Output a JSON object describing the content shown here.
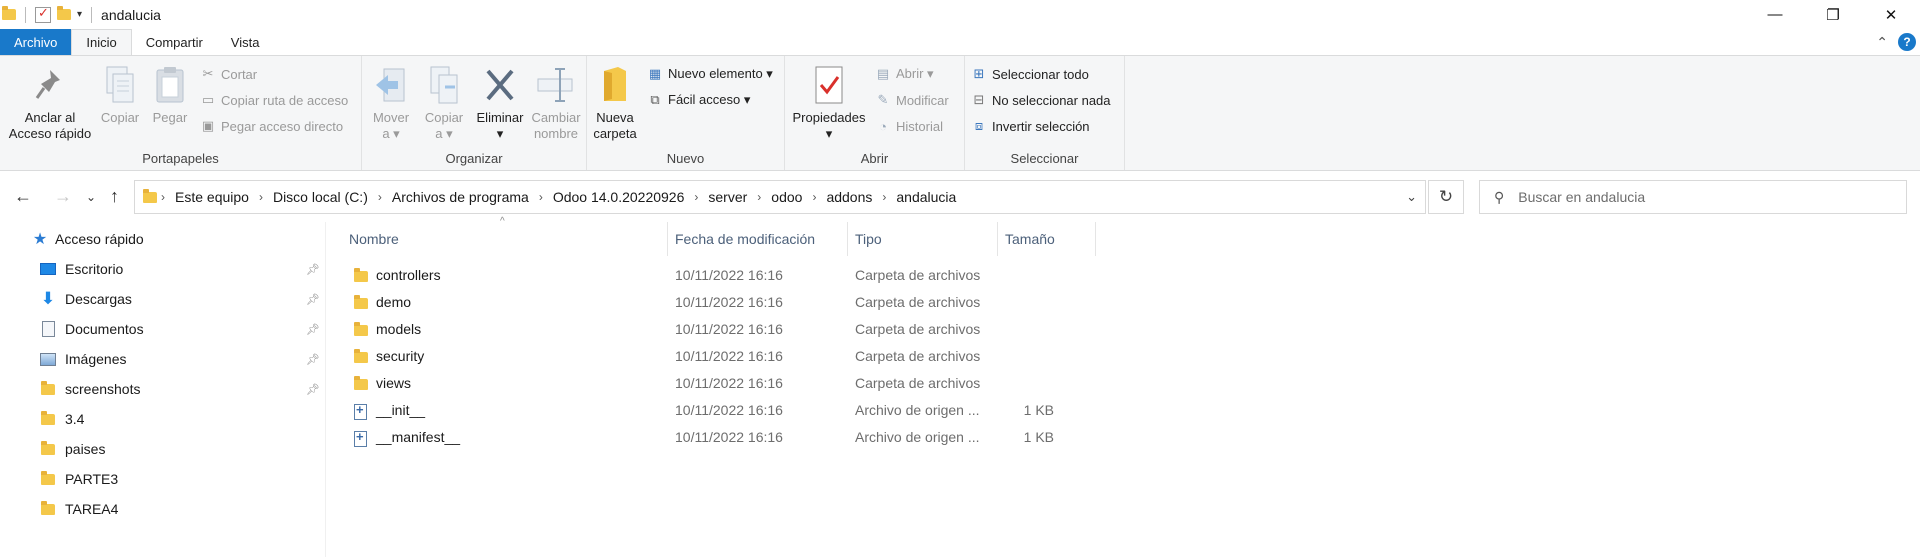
{
  "title_bar": {
    "title": "andalucia",
    "minimize": "—",
    "restore": "❐",
    "close": "✕"
  },
  "ribbon_tabs": {
    "file": "Archivo",
    "tabs": [
      "Inicio",
      "Compartir",
      "Vista"
    ],
    "collapse": "⌃",
    "help": "?"
  },
  "ribbon": {
    "portapapeles": {
      "label": "Portapapeles",
      "pin": "Anclar al\nAcceso rápido",
      "copy": "Copiar",
      "paste": "Pegar",
      "cut": "Cortar",
      "copy_path": "Copiar ruta de acceso",
      "paste_shortcut": "Pegar acceso directo"
    },
    "organizar": {
      "label": "Organizar",
      "move": "Mover\na ▾",
      "copy_to": "Copiar\na ▾",
      "delete": "Eliminar\n▾",
      "rename": "Cambiar\nnombre"
    },
    "nuevo": {
      "label": "Nuevo",
      "new_folder": "Nueva\ncarpeta",
      "new_item": "Nuevo elemento ▾",
      "easy_access": "Fácil acceso ▾"
    },
    "abrir": {
      "label": "Abrir",
      "properties": "Propiedades\n▾",
      "open": "Abrir ▾",
      "edit": "Modificar",
      "history": "Historial"
    },
    "seleccionar": {
      "label": "Seleccionar",
      "select_all": "Seleccionar todo",
      "select_none": "No seleccionar nada",
      "invert": "Invertir selección"
    }
  },
  "nav": {
    "back": "←",
    "forward": "→",
    "recent": "⌄",
    "up": "↑",
    "breadcrumbs": [
      "Este equipo",
      "Disco local (C:)",
      "Archivos de programa",
      "Odoo 14.0.20220926",
      "server",
      "odoo",
      "addons",
      "andalucia"
    ],
    "crumb_separator": "›",
    "dropdown": "⌄",
    "refresh": "↻",
    "search_placeholder": "Buscar en andalucia"
  },
  "sidebar": {
    "quick_access": "Acceso rápido",
    "items": [
      {
        "label": "Escritorio",
        "icon": "desktop-icon",
        "pinned": true
      },
      {
        "label": "Descargas",
        "icon": "downloads-icon",
        "pinned": true
      },
      {
        "label": "Documentos",
        "icon": "documents-icon",
        "pinned": true
      },
      {
        "label": "Imágenes",
        "icon": "pictures-icon",
        "pinned": true
      },
      {
        "label": "screenshots",
        "icon": "folder-icon",
        "pinned": true
      },
      {
        "label": "3.4",
        "icon": "folder-icon",
        "pinned": false
      },
      {
        "label": "paises",
        "icon": "folder-icon",
        "pinned": false
      },
      {
        "label": "PARTE3",
        "icon": "folder-icon",
        "pinned": false
      },
      {
        "label": "TAREA4",
        "icon": "folder-icon",
        "pinned": false
      }
    ]
  },
  "file_list": {
    "columns": {
      "name": "Nombre",
      "date": "Fecha de modificación",
      "type": "Tipo",
      "size": "Tamaño"
    },
    "sort_indicator": "^",
    "rows": [
      {
        "name": "controllers",
        "date": "10/11/2022 16:16",
        "type": "Carpeta de archivos",
        "size": "",
        "icon": "folder-icon"
      },
      {
        "name": "demo",
        "date": "10/11/2022 16:16",
        "type": "Carpeta de archivos",
        "size": "",
        "icon": "folder-icon"
      },
      {
        "name": "models",
        "date": "10/11/2022 16:16",
        "type": "Carpeta de archivos",
        "size": "",
        "icon": "folder-icon"
      },
      {
        "name": "security",
        "date": "10/11/2022 16:16",
        "type": "Carpeta de archivos",
        "size": "",
        "icon": "folder-icon"
      },
      {
        "name": "views",
        "date": "10/11/2022 16:16",
        "type": "Carpeta de archivos",
        "size": "",
        "icon": "folder-icon"
      },
      {
        "name": "__init__",
        "date": "10/11/2022 16:16",
        "type": "Archivo de origen ...",
        "size": "1 KB",
        "icon": "python-file-icon"
      },
      {
        "name": "__manifest__",
        "date": "10/11/2022 16:16",
        "type": "Archivo de origen ...",
        "size": "1 KB",
        "icon": "python-file-icon"
      }
    ]
  },
  "colors": {
    "accent": "#1979ca",
    "folder": "#f4c84a",
    "header_text": "#4c607a"
  }
}
